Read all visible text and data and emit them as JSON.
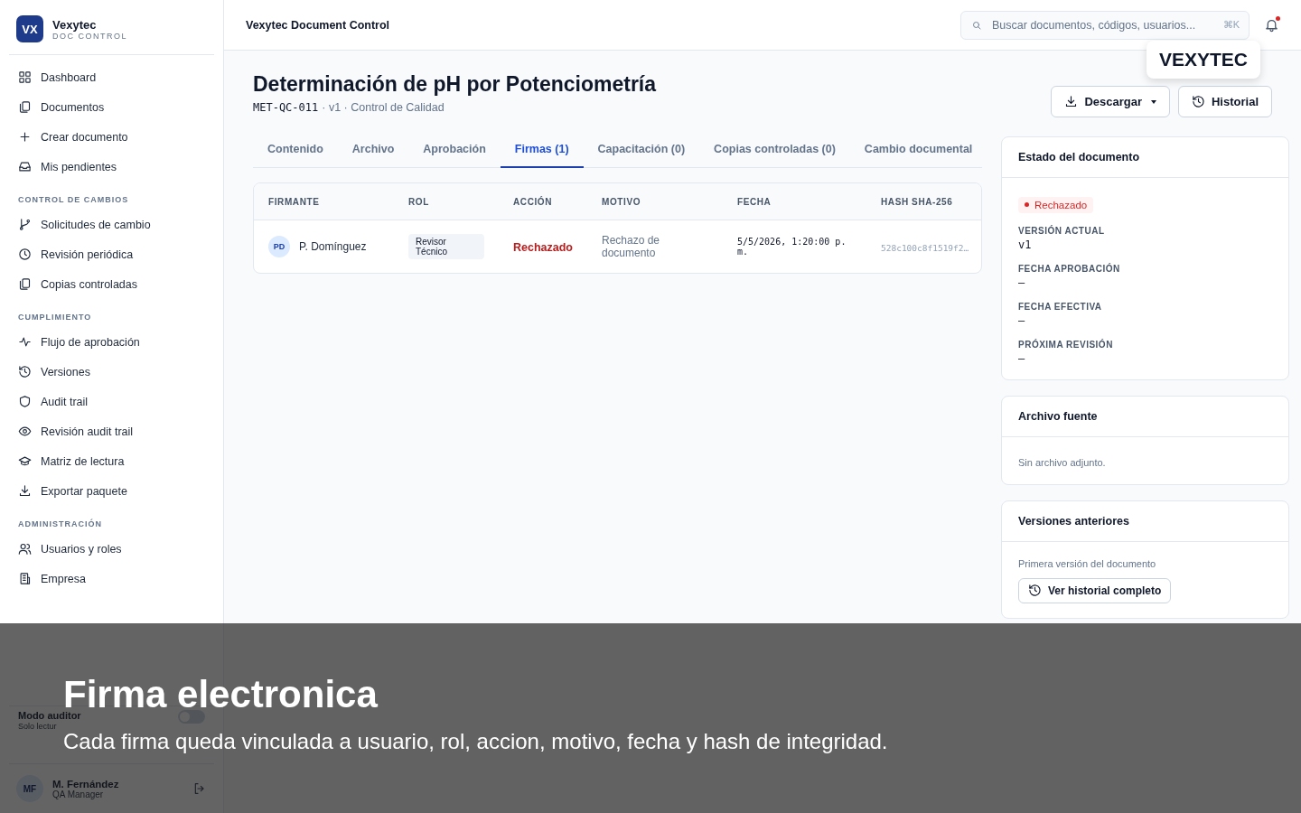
{
  "brand": {
    "logo": "VX",
    "name": "Vexytec",
    "subtitle": "DOC CONTROL"
  },
  "sidebar": {
    "sections": [
      {
        "items": [
          {
            "label": "Dashboard",
            "selected": false
          },
          {
            "label": "Documentos",
            "selected": false
          },
          {
            "label": "Crear documento",
            "selected": false
          },
          {
            "label": "Mis pendientes",
            "selected": false
          }
        ]
      },
      {
        "heading": "CONTROL DE CAMBIOS",
        "items": [
          {
            "label": "Solicitudes de cambio",
            "selected": false
          },
          {
            "label": "Revisión periódica",
            "selected": false
          },
          {
            "label": "Copias controladas",
            "selected": false
          }
        ]
      },
      {
        "heading": "CUMPLIMIENTO",
        "items": [
          {
            "label": "Flujo de aprobación",
            "selected": false
          },
          {
            "label": "Versiones",
            "selected": false
          },
          {
            "label": "Audit trail",
            "selected": false
          },
          {
            "label": "Revisión audit trail",
            "selected": false
          },
          {
            "label": "Matriz de lectura",
            "selected": false
          },
          {
            "label": "Exportar paquete",
            "selected": false
          }
        ]
      },
      {
        "heading": "ADMINISTRACIÓN",
        "items": [
          {
            "label": "Usuarios y roles",
            "selected": false
          },
          {
            "label": "Empresa",
            "selected": false
          }
        ]
      }
    ],
    "auditor_mode": {
      "label": "Modo auditor",
      "hint": "Solo lectur",
      "on": false
    },
    "user": {
      "initials": "MF",
      "name": "M. Fernández",
      "role": "QA Manager"
    }
  },
  "topbar": {
    "title": "Vexytec Document Control",
    "search": {
      "placeholder": "Buscar documentos, códigos, usuarios...",
      "shortcut": "⌘K"
    },
    "notifications_unread": true
  },
  "brand_badge": "VEXYTEC",
  "document": {
    "title": "Determinación de pH por Potenciometría",
    "code": "MET-QC-011",
    "meta": "· v1 · Control de Calidad",
    "actions": [
      "Descargar",
      "Historial"
    ],
    "tabs": [
      {
        "label": "Contenido",
        "selected": false
      },
      {
        "label": "Archivo",
        "selected": false
      },
      {
        "label": "Aprobación",
        "selected": false
      },
      {
        "label": "Firmas (1)",
        "selected": true
      },
      {
        "label": "Capacitación (0)",
        "selected": false
      },
      {
        "label": "Copias controladas (0)",
        "selected": false
      },
      {
        "label": "Cambio documental",
        "selected": false
      }
    ]
  },
  "signatures": {
    "columns": [
      "FIRMANTE",
      "ROL",
      "ACCIÓN",
      "MOTIVO",
      "FECHA",
      "HASH SHA-256"
    ],
    "rows": [
      {
        "initials": "PD",
        "signer": "P. Domínguez",
        "role": "Revisor Técnico",
        "action": "Rechazado",
        "color": "#b91c1c",
        "reason": "Rechazo de documento",
        "date": "5/5/2026, 1:20:00 p. m.",
        "hash": "528c100c8f1519f2…"
      }
    ]
  },
  "status_card": {
    "title": "Estado del documento",
    "status": {
      "label": "Rechazado",
      "color": "#dc2626"
    },
    "fields": [
      {
        "label": "VERSIÓN ACTUAL",
        "value": "v1"
      },
      {
        "label": "FECHA APROBACIÓN",
        "value": "—"
      },
      {
        "label": "FECHA EFECTIVA",
        "value": "—"
      },
      {
        "label": "PRÓXIMA REVISIÓN",
        "value": "—"
      }
    ]
  },
  "source_file": {
    "title": "Archivo fuente",
    "text": "Sin archivo adjunto."
  },
  "previous_versions": {
    "title": "Versiones anteriores",
    "text": "Primera versión del documento",
    "button": "Ver historial completo"
  },
  "caption": {
    "title": "Firma electronica",
    "text": "Cada firma queda vinculada a usuario, rol, accion, motivo, fecha y hash de integridad."
  }
}
